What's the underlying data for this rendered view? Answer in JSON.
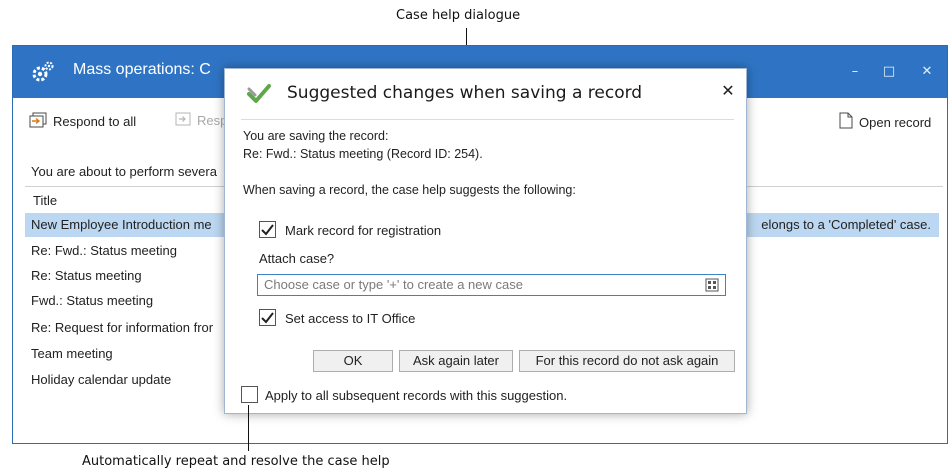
{
  "annotations": {
    "top_label": "Case help dialogue",
    "bottom_label": "Automatically repeat and resolve the case help"
  },
  "window": {
    "title": "Mass operations: C",
    "controls": {
      "minimize": "–",
      "maximize": "□",
      "close": "✕"
    }
  },
  "toolbar": {
    "respond_all_label": "Respond to all",
    "respond_label": "Resp",
    "open_record_label": "Open record"
  },
  "main": {
    "intro_text": "You are about to perform severa",
    "column_title": "Title",
    "rows": [
      {
        "title": "New Employee Introduction me",
        "extra": "elongs to a 'Completed' case."
      },
      {
        "title": "Re: Fwd.: Status meeting"
      },
      {
        "title": "Re: Status meeting"
      },
      {
        "title": "Fwd.: Status meeting"
      },
      {
        "title": "Re: Request for information fror"
      },
      {
        "title": "Team meeting"
      },
      {
        "title": "Holiday calendar update"
      }
    ]
  },
  "dialog": {
    "title": "Suggested changes when saving a record",
    "close": "✕",
    "saving_line1": "You are saving the record:",
    "saving_line2": "Re: Fwd.: Status meeting (Record ID: 254).",
    "suggest_text": "When saving a record, the case help suggests the following:",
    "mark_registration_label": "Mark record for registration",
    "attach_case_label": "Attach case?",
    "case_input_placeholder": "Choose case or type '+' to create a new case",
    "set_access_label": "Set access to IT Office",
    "ok_label": "OK",
    "ask_later_label": "Ask again later",
    "do_not_ask_label": "For this record do not ask again",
    "apply_all_label": "Apply to all subsequent records with this suggestion."
  },
  "colors": {
    "titlebar": "#2f74c4",
    "selection": "#bcd7f1",
    "input_border": "#3b82c9",
    "check_green": "#5fa84a"
  }
}
